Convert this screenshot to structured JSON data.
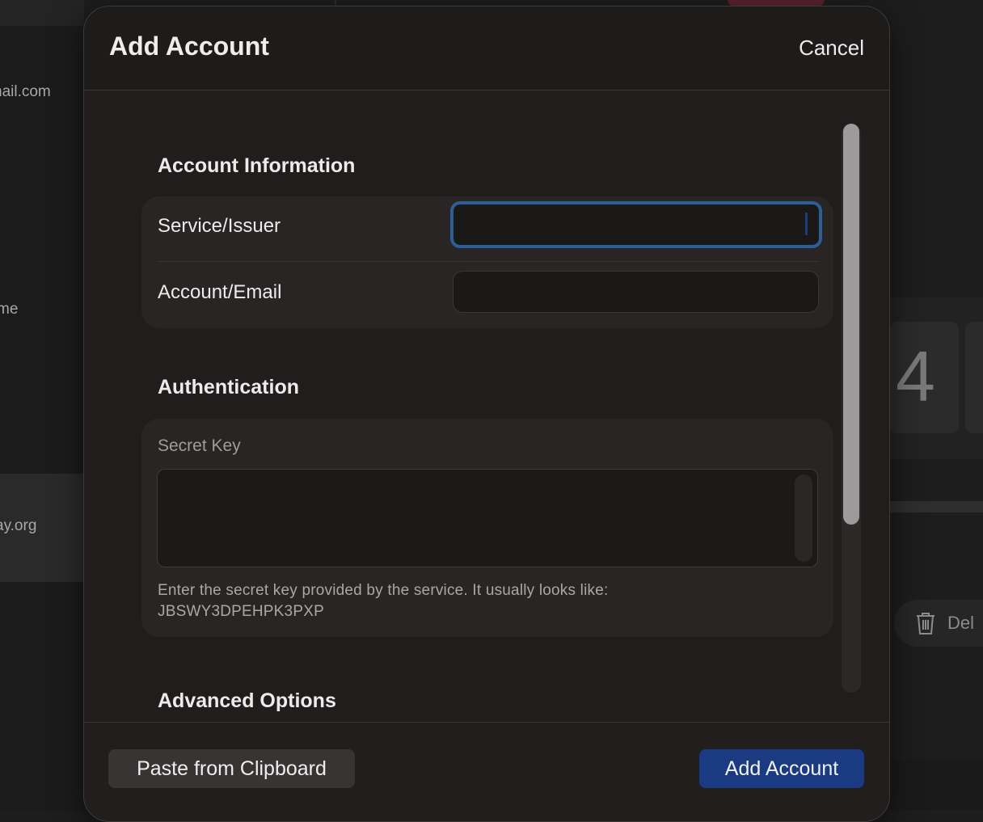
{
  "background": {
    "sidebar_items": [
      {
        "text": "nail.com"
      },
      {
        "text": "me"
      },
      {
        "text": "ay.org"
      }
    ],
    "code_digit": "4",
    "delete_label": "Del"
  },
  "modal": {
    "title": "Add Account",
    "cancel_label": "Cancel",
    "sections": {
      "account_info": {
        "title": "Account Information",
        "service_label": "Service/Issuer",
        "service_value": "",
        "account_label": "Account/Email",
        "account_value": ""
      },
      "authentication": {
        "title": "Authentication",
        "secret_key_label": "Secret Key",
        "secret_key_value": "",
        "help_line1": "Enter the secret key provided by the service. It usually looks like:",
        "help_line2": "JBSWY3DPEHPK3PXP"
      },
      "advanced": {
        "title": "Advanced Options"
      }
    },
    "footer": {
      "paste_label": "Paste from Clipboard",
      "submit_label": "Add Account"
    }
  },
  "colors": {
    "accent": "#1a3a82",
    "focus_ring": "#2e5e98",
    "modal_bg": "#211d1d",
    "group_bg": "#2a2525"
  }
}
